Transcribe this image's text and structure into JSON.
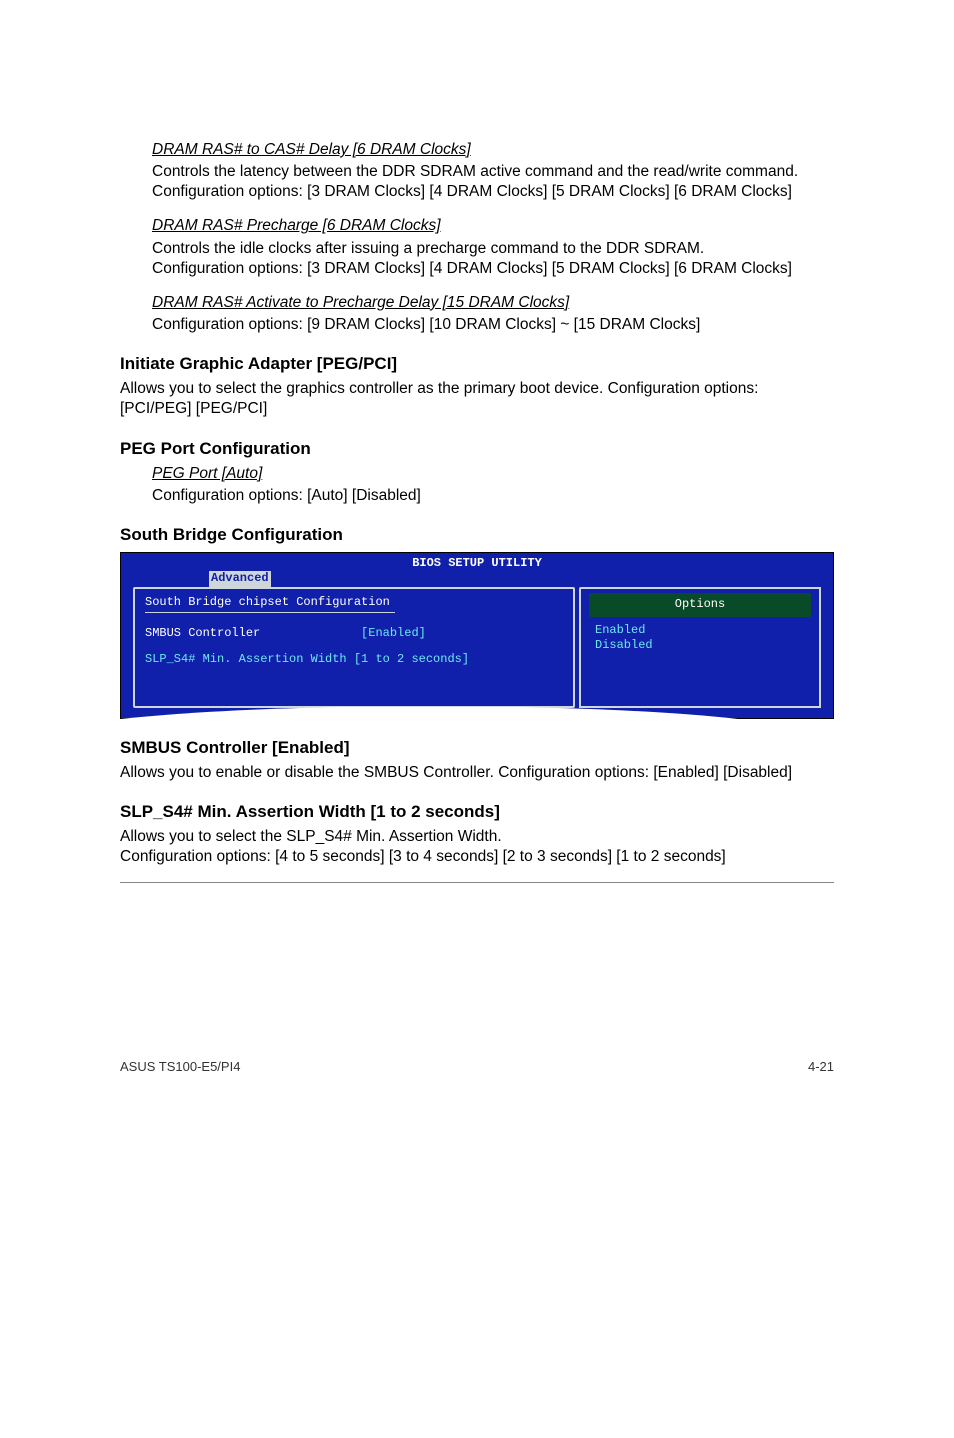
{
  "section_ras_cas": {
    "heading": "DRAM RAS# to CAS# Delay [6 DRAM Clocks]",
    "line1": "Controls the latency between the DDR SDRAM active command and the read/write command.",
    "line2": "Configuration options: [3 DRAM Clocks] [4 DRAM Clocks] [5 DRAM Clocks] [6 DRAM Clocks]"
  },
  "section_ras_precharge": {
    "heading": "DRAM RAS# Precharge [6 DRAM Clocks]",
    "line1": "Controls the idle clocks after issuing a precharge command to the DDR SDRAM.",
    "line2": "Configuration options: [3 DRAM Clocks] [4 DRAM Clocks] [5 DRAM Clocks] [6 DRAM Clocks]"
  },
  "section_ras_activate": {
    "heading": "DRAM RAS# Activate to Precharge Delay [15 DRAM Clocks]",
    "line1": "Configuration options: [9 DRAM Clocks] [10 DRAM Clocks] ~ [15 DRAM Clocks]"
  },
  "initiate": {
    "heading": "Initiate Graphic Adapter [PEG/PCI]",
    "body": "Allows you to select the graphics controller as the primary boot device. Configuration options: [PCI/PEG] [PEG/PCI]"
  },
  "peg_port_cfg": {
    "heading": "PEG Port Configuration",
    "sub_heading": "PEG Port [Auto]",
    "body": "Configuration options: [Auto] [Disabled]"
  },
  "south_bridge_heading": "South Bridge Configuration",
  "bios": {
    "title": "BIOS SETUP UTILITY",
    "tab": "Advanced",
    "section_title": "South Bridge chipset Configuration",
    "row1_label": "SMBUS Controller",
    "row1_value": "[Enabled]",
    "row2_label": "SLP_S4# Min. Assertion Width",
    "row2_value": "[1 to 2 seconds]",
    "options_header": "Options",
    "opt1": "Enabled",
    "opt2": "Disabled"
  },
  "smbus": {
    "heading": "SMBUS Controller [Enabled]",
    "body": "Allows you to enable or disable the SMBUS Controller. Configuration options: [Enabled] [Disabled]"
  },
  "slp_s4": {
    "heading": "SLP_S4# Min. Assertion Width [1 to 2 seconds]",
    "line1": "Allows you to select the SLP_S4# Min. Assertion Width.",
    "line2": "Configuration options: [4 to 5 seconds] [3 to 4 seconds] [2 to 3 seconds] [1 to 2 seconds]"
  },
  "footer_left": "ASUS TS100-E5/PI4",
  "footer_right": "4-21"
}
